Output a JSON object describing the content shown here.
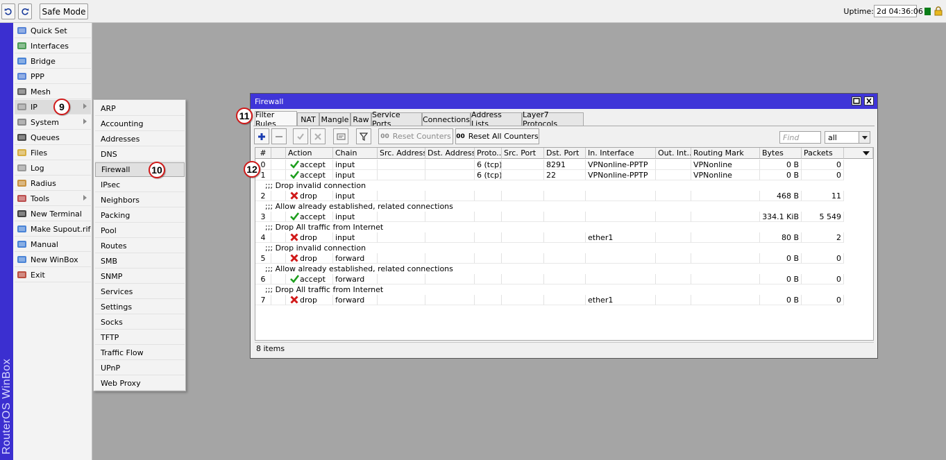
{
  "toolbar": {
    "undo": "undo-icon",
    "redo": "redo-icon",
    "safe_mode": "Safe Mode",
    "uptime_label": "Uptime:",
    "uptime_value": "2d 04:36:06"
  },
  "brand": "RouterOS WinBox",
  "left_menu": [
    {
      "label": "Quick Set",
      "icon": "quick-set-icon"
    },
    {
      "label": "Interfaces",
      "icon": "interfaces-icon"
    },
    {
      "label": "Bridge",
      "icon": "bridge-icon"
    },
    {
      "label": "PPP",
      "icon": "ppp-icon"
    },
    {
      "label": "Mesh",
      "icon": "mesh-icon"
    },
    {
      "label": "IP",
      "icon": "ip-icon",
      "submenu": true
    },
    {
      "label": "System",
      "icon": "system-icon",
      "submenu": true
    },
    {
      "label": "Queues",
      "icon": "queues-icon"
    },
    {
      "label": "Files",
      "icon": "files-icon"
    },
    {
      "label": "Log",
      "icon": "log-icon"
    },
    {
      "label": "Radius",
      "icon": "radius-icon"
    },
    {
      "label": "Tools",
      "icon": "tools-icon",
      "submenu": true
    },
    {
      "label": "New Terminal",
      "icon": "terminal-icon"
    },
    {
      "label": "Make Supout.rif",
      "icon": "supout-icon"
    },
    {
      "label": "Manual",
      "icon": "manual-icon"
    },
    {
      "label": "New WinBox",
      "icon": "winbox-icon"
    },
    {
      "label": "Exit",
      "icon": "exit-icon"
    }
  ],
  "ip_submenu": [
    "ARP",
    "Accounting",
    "Addresses",
    "DNS",
    "Firewall",
    "IPsec",
    "Neighbors",
    "Packing",
    "Pool",
    "Routes",
    "SMB",
    "SNMP",
    "Services",
    "Settings",
    "Socks",
    "TFTP",
    "Traffic Flow",
    "UPnP",
    "Web Proxy"
  ],
  "badges": {
    "b9": "9",
    "b10": "10",
    "b11": "11",
    "b12": "12"
  },
  "firewall": {
    "title": "Firewall",
    "tabs": [
      "Filter Rules",
      "NAT",
      "Mangle",
      "Raw",
      "Service Ports",
      "Connections",
      "Address Lists",
      "Layer7 Protocols"
    ],
    "tools": {
      "reset_counters": "Reset Counters",
      "reset_all_counters": "Reset All Counters",
      "counter_prefix": "00",
      "find_placeholder": "Find",
      "filter_value": "all"
    },
    "columns": [
      "#",
      "",
      "Action",
      "Chain",
      "Src. Address",
      "Dst. Address",
      "Proto...",
      "Src. Port",
      "Dst. Port",
      "In. Interface",
      "Out. Int...",
      "Routing Mark",
      "Bytes",
      "Packets"
    ],
    "rows": [
      {
        "type": "rule",
        "num": "0",
        "action": "accept",
        "chain": "input",
        "proto": "6 (tcp)",
        "dst_port": "8291",
        "in_iface": "VPNonline-PPTP",
        "routing_mark": "VPNonline",
        "bytes": "0 B",
        "packets": "0"
      },
      {
        "type": "rule",
        "num": "1",
        "action": "accept",
        "chain": "input",
        "proto": "6 (tcp)",
        "dst_port": "22",
        "in_iface": "VPNonline-PPTP",
        "routing_mark": "VPNonline",
        "bytes": "0 B",
        "packets": "0"
      },
      {
        "type": "comment",
        "text": ";;; Drop invalid connection"
      },
      {
        "type": "rule",
        "num": "2",
        "action": "drop",
        "chain": "input",
        "proto": "",
        "dst_port": "",
        "in_iface": "",
        "routing_mark": "",
        "bytes": "468 B",
        "packets": "11"
      },
      {
        "type": "comment",
        "text": ";;; Allow already established, related connections"
      },
      {
        "type": "rule",
        "num": "3",
        "action": "accept",
        "chain": "input",
        "proto": "",
        "dst_port": "",
        "in_iface": "",
        "routing_mark": "",
        "bytes": "334.1 KiB",
        "packets": "5 549"
      },
      {
        "type": "comment",
        "text": ";;; Drop All traffic from Internet"
      },
      {
        "type": "rule",
        "num": "4",
        "action": "drop",
        "chain": "input",
        "proto": "",
        "dst_port": "",
        "in_iface": "ether1",
        "routing_mark": "",
        "bytes": "80 B",
        "packets": "2"
      },
      {
        "type": "comment",
        "text": ";;; Drop invalid connection"
      },
      {
        "type": "rule",
        "num": "5",
        "action": "drop",
        "chain": "forward",
        "proto": "",
        "dst_port": "",
        "in_iface": "",
        "routing_mark": "",
        "bytes": "0 B",
        "packets": "0"
      },
      {
        "type": "comment",
        "text": ";;; Allow already established, related connections"
      },
      {
        "type": "rule",
        "num": "6",
        "action": "accept",
        "chain": "forward",
        "proto": "",
        "dst_port": "",
        "in_iface": "",
        "routing_mark": "",
        "bytes": "0 B",
        "packets": "0"
      },
      {
        "type": "comment",
        "text": ";;; Drop All traffic from Internet"
      },
      {
        "type": "rule",
        "num": "7",
        "action": "drop",
        "chain": "forward",
        "proto": "",
        "dst_port": "",
        "in_iface": "ether1",
        "routing_mark": "",
        "bytes": "0 B",
        "packets": "0"
      }
    ],
    "status": "8 items"
  },
  "colors": {
    "accent": "#3f35d8",
    "accept": "#1e9e1e",
    "drop": "#d01818",
    "badge_ring": "#d01818"
  }
}
